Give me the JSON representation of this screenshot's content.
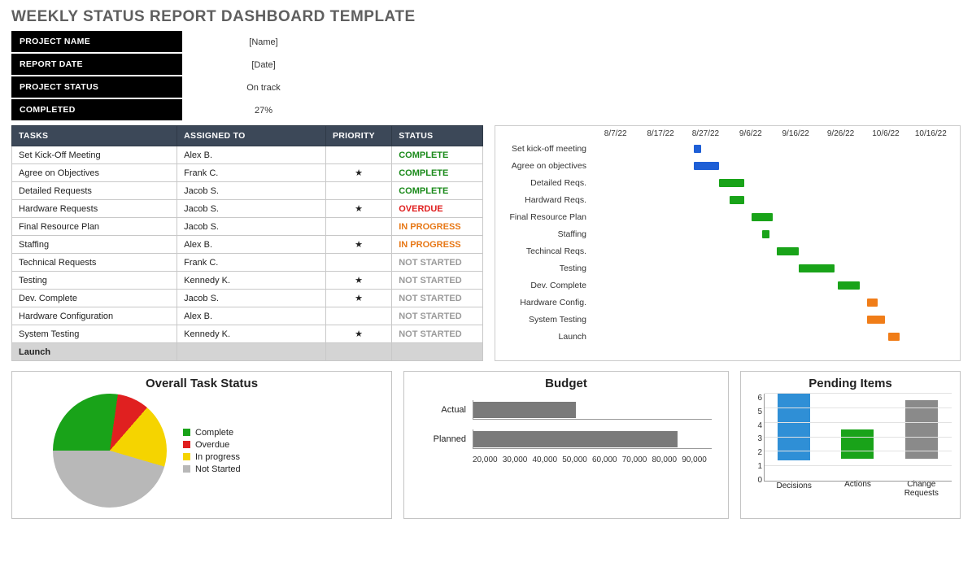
{
  "title": "WEEKLY STATUS REPORT DASHBOARD TEMPLATE",
  "summary": {
    "labels": [
      "PROJECT NAME",
      "REPORT DATE",
      "PROJECT STATUS",
      "COMPLETED"
    ],
    "values": [
      "[Name]",
      "[Date]",
      "On track",
      "27%"
    ]
  },
  "task_headers": [
    "TASKS",
    "ASSIGNED TO",
    "PRIORITY",
    "STATUS"
  ],
  "tasks": [
    {
      "task": "Set Kick-Off Meeting",
      "assigned": "Alex B.",
      "priority": false,
      "status": "COMPLETE"
    },
    {
      "task": "Agree on Objectives",
      "assigned": "Frank C.",
      "priority": true,
      "status": "COMPLETE"
    },
    {
      "task": "Detailed Requests",
      "assigned": "Jacob S.",
      "priority": false,
      "status": "COMPLETE"
    },
    {
      "task": "Hardware Requests",
      "assigned": "Jacob S.",
      "priority": true,
      "status": "OVERDUE"
    },
    {
      "task": "Final Resource Plan",
      "assigned": "Jacob S.",
      "priority": false,
      "status": "IN PROGRESS"
    },
    {
      "task": "Staffing",
      "assigned": "Alex B.",
      "priority": true,
      "status": "IN PROGRESS"
    },
    {
      "task": "Technical Requests",
      "assigned": "Frank C.",
      "priority": false,
      "status": "NOT STARTED"
    },
    {
      "task": "Testing",
      "assigned": "Kennedy K.",
      "priority": true,
      "status": "NOT STARTED"
    },
    {
      "task": "Dev. Complete",
      "assigned": "Jacob S.",
      "priority": true,
      "status": "NOT STARTED"
    },
    {
      "task": "Hardware Configuration",
      "assigned": "Alex B.",
      "priority": false,
      "status": "NOT STARTED"
    },
    {
      "task": "System Testing",
      "assigned": "Kennedy K.",
      "priority": true,
      "status": "NOT STARTED"
    }
  ],
  "launch_label": "Launch",
  "gantt": {
    "dates": [
      "8/7/22",
      "8/17/22",
      "8/27/22",
      "9/6/22",
      "9/16/22",
      "9/26/22",
      "10/6/22",
      "10/16/22"
    ],
    "rows": [
      {
        "label": "Set kick-off meeting",
        "start": 28,
        "width": 2,
        "color": "#1e5fd6"
      },
      {
        "label": "Agree on objectives",
        "start": 28,
        "width": 7,
        "color": "#1e5fd6"
      },
      {
        "label": "Detailed Reqs.",
        "start": 35,
        "width": 7,
        "color": "#19a319"
      },
      {
        "label": "Hardward Reqs.",
        "start": 38,
        "width": 4,
        "color": "#19a319"
      },
      {
        "label": "Final Resource Plan",
        "start": 44,
        "width": 6,
        "color": "#19a319"
      },
      {
        "label": "Staffing",
        "start": 47,
        "width": 2,
        "color": "#19a319"
      },
      {
        "label": "Techincal Reqs.",
        "start": 51,
        "width": 6,
        "color": "#19a319"
      },
      {
        "label": "Testing",
        "start": 57,
        "width": 10,
        "color": "#19a319"
      },
      {
        "label": "Dev. Complete",
        "start": 68,
        "width": 6,
        "color": "#19a319"
      },
      {
        "label": "Hardware Config.",
        "start": 76,
        "width": 3,
        "color": "#f07d18"
      },
      {
        "label": "System Testing",
        "start": 76,
        "width": 5,
        "color": "#f07d18"
      },
      {
        "label": "Launch",
        "start": 82,
        "width": 3,
        "color": "#f07d18"
      }
    ]
  },
  "chart_data": [
    {
      "type": "pie",
      "title": "Overall Task Status",
      "series": [
        {
          "name": "Complete",
          "value": 3,
          "color": "#19a319"
        },
        {
          "name": "Overdue",
          "value": 1,
          "color": "#e02020"
        },
        {
          "name": "In progress",
          "value": 2,
          "color": "#f5d400"
        },
        {
          "name": "Not Started",
          "value": 5,
          "color": "#b8b8b8"
        }
      ]
    },
    {
      "type": "bar",
      "title": "Budget",
      "orientation": "horizontal",
      "categories": [
        "Actual",
        "Planned"
      ],
      "values": [
        50000,
        80000
      ],
      "xlim": [
        20000,
        90000
      ],
      "xticks": [
        20000,
        30000,
        40000,
        50000,
        60000,
        70000,
        80000,
        90000
      ],
      "color": "#7a7a7a"
    },
    {
      "type": "bar",
      "title": "Pending Items",
      "categories": [
        "Decisions",
        "Actions",
        "Change Requests"
      ],
      "values": [
        5,
        2,
        4
      ],
      "colors": [
        "#2f8fd6",
        "#19a319",
        "#8a8a8a"
      ],
      "ylim": [
        0,
        6
      ]
    }
  ]
}
